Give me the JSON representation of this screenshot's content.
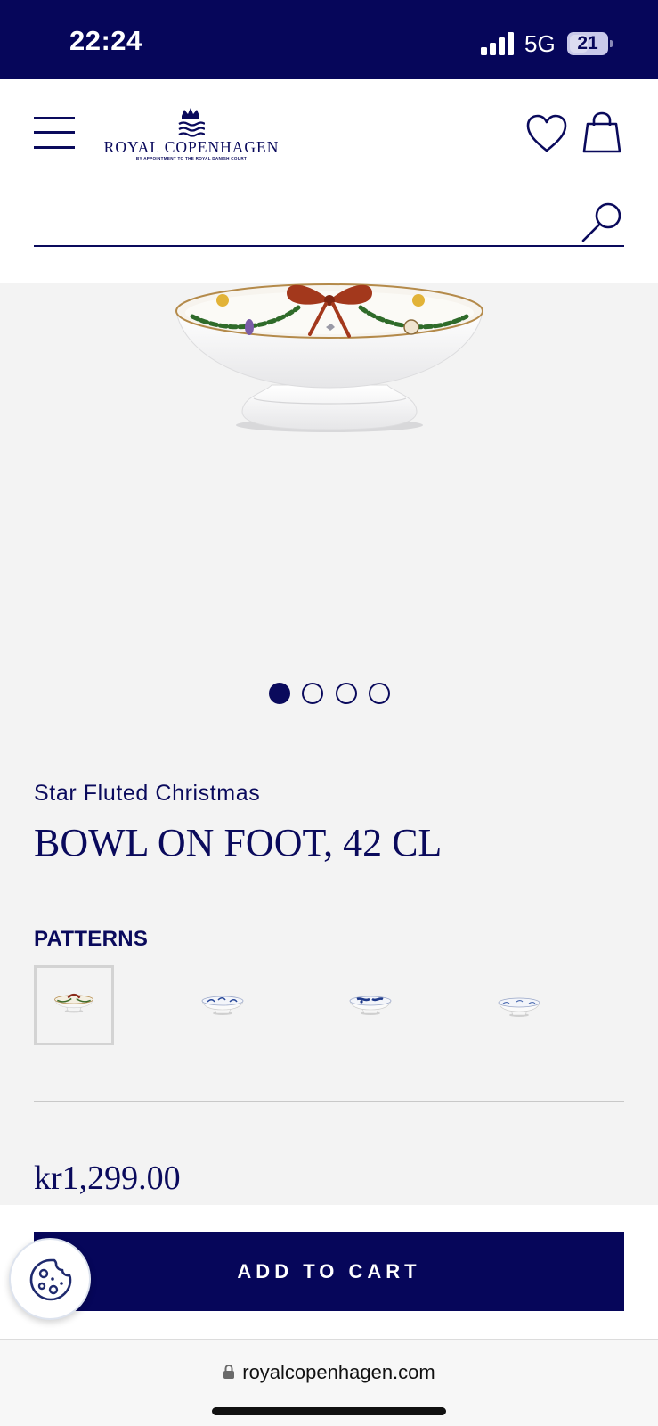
{
  "status_bar": {
    "time": "22:24",
    "network": "5G",
    "battery": "21"
  },
  "header": {
    "brand": "ROYAL COPENHAGEN",
    "brand_tagline": "BY APPOINTMENT TO THE ROYAL DANISH COURT",
    "search": {
      "value": "",
      "placeholder": ""
    },
    "icons": [
      "menu-icon",
      "crown-icon",
      "heart-icon",
      "bag-icon",
      "search-icon"
    ]
  },
  "gallery": {
    "image_count": 4,
    "active_index": 0
  },
  "product": {
    "collection": "Star Fluted Christmas",
    "title": "BOWL ON FOOT, 42 CL",
    "patterns_label": "PATTERNS",
    "patterns": [
      {
        "name": "star-fluted-christmas",
        "selected": true
      },
      {
        "name": "blue-fluted",
        "selected": false
      },
      {
        "name": "blue-fluted-mega",
        "selected": false
      },
      {
        "name": "blue-fluted-plain",
        "selected": false
      }
    ],
    "price": "kr1,299.00"
  },
  "actions": {
    "add_to_cart": "ADD TO CART"
  },
  "browser": {
    "url": "royalcopenhagen.com"
  },
  "colors": {
    "brand_navy": "#06065a",
    "text_navy": "#0a0a5c",
    "page_bg": "#f3f3f3"
  }
}
